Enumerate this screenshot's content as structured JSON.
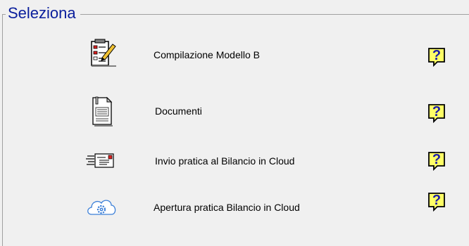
{
  "group": {
    "title": "Seleziona"
  },
  "rows": [
    {
      "label": "Compilazione Modello B",
      "icon": "checklist-edit-icon",
      "help": "?"
    },
    {
      "label": "Documenti",
      "icon": "document-icon",
      "help": "?"
    },
    {
      "label": "Invio pratica al Bilancio in Cloud",
      "icon": "send-envelope-icon",
      "help": "?"
    },
    {
      "label": "Apertura pratica Bilancio in Cloud",
      "icon": "cloud-gear-icon",
      "help": "?"
    }
  ],
  "colors": {
    "legend_text": "#0a1e9c",
    "help_fill": "#ffff66",
    "help_border": "#000000",
    "help_mark": "#1a1aa8",
    "cloud_blue": "#3b7fd8"
  }
}
